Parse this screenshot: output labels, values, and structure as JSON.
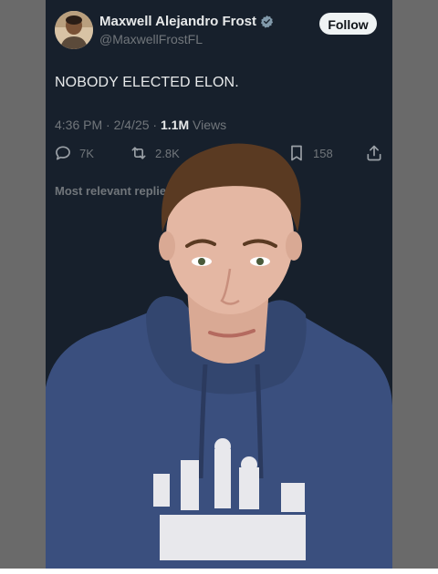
{
  "tweet": {
    "author": {
      "display_name": "Maxwell Alejandro Frost",
      "handle": "@MaxwellFrostFL",
      "verified": true
    },
    "follow_label": "Follow",
    "text": "NOBODY ELECTED ELON.",
    "time": "4:36 PM",
    "date": "2/4/25",
    "separator": " · ",
    "views_count": "1.1M",
    "views_label": "Views",
    "actions": {
      "replies": "7K",
      "reposts": "2.8K",
      "bookmarks": "158"
    },
    "replies_section_label": "Most relevant replie"
  },
  "colors": {
    "card_bg": "#17202c",
    "text_primary": "#e7e9ea",
    "text_secondary": "#71767b",
    "verified_badge": "#829aab",
    "follow_bg": "#eff3f4",
    "hoodie": "#3a4f7e",
    "frame": "#6a6a6a"
  },
  "icons": [
    "verified-badge-icon",
    "reply-icon",
    "repost-icon",
    "bookmark-icon",
    "share-icon"
  ]
}
